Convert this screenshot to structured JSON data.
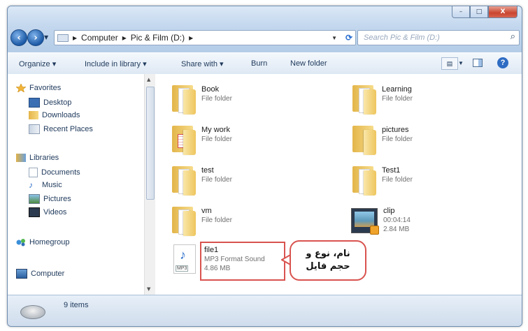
{
  "window": {
    "min": "–",
    "max": "□",
    "close": "X"
  },
  "address": {
    "path": [
      "Computer",
      "Pic & Film (D:)"
    ],
    "sep": "▸"
  },
  "search": {
    "placeholder": "Search Pic & Film (D:)"
  },
  "toolbar": {
    "organize": "Organize ▾",
    "include": "Include in library ▾",
    "share": "Share with ▾",
    "burn": "Burn",
    "newfolder": "New folder",
    "help": "?"
  },
  "sidebar": {
    "favorites": "Favorites",
    "desktop": "Desktop",
    "downloads": "Downloads",
    "recent": "Recent Places",
    "libraries": "Libraries",
    "documents": "Documents",
    "music": "Music",
    "pictures": "Pictures",
    "videos": "Videos",
    "homegroup": "Homegroup",
    "computer": "Computer"
  },
  "files": [
    {
      "name": "Book",
      "sub": "File folder"
    },
    {
      "name": "Learning",
      "sub": "File folder"
    },
    {
      "name": "My work",
      "sub": "File folder"
    },
    {
      "name": "pictures",
      "sub": "File folder"
    },
    {
      "name": "test",
      "sub": "File folder"
    },
    {
      "name": "Test1",
      "sub": "File folder"
    },
    {
      "name": "vm",
      "sub": "File folder"
    },
    {
      "name": "clip",
      "sub": "00:04:14",
      "sub2": "2.84 MB"
    },
    {
      "name": "file1",
      "sub": "MP3 Format Sound",
      "sub2": "4.86 MB"
    }
  ],
  "mp3_label": "MP3",
  "callout": {
    "line1": "نام، نوع و",
    "line2": "حجم فایل"
  },
  "status": {
    "items": "9 items"
  },
  "colors": {
    "highlight": "#d9534f",
    "accent": "#2f6cc3"
  }
}
